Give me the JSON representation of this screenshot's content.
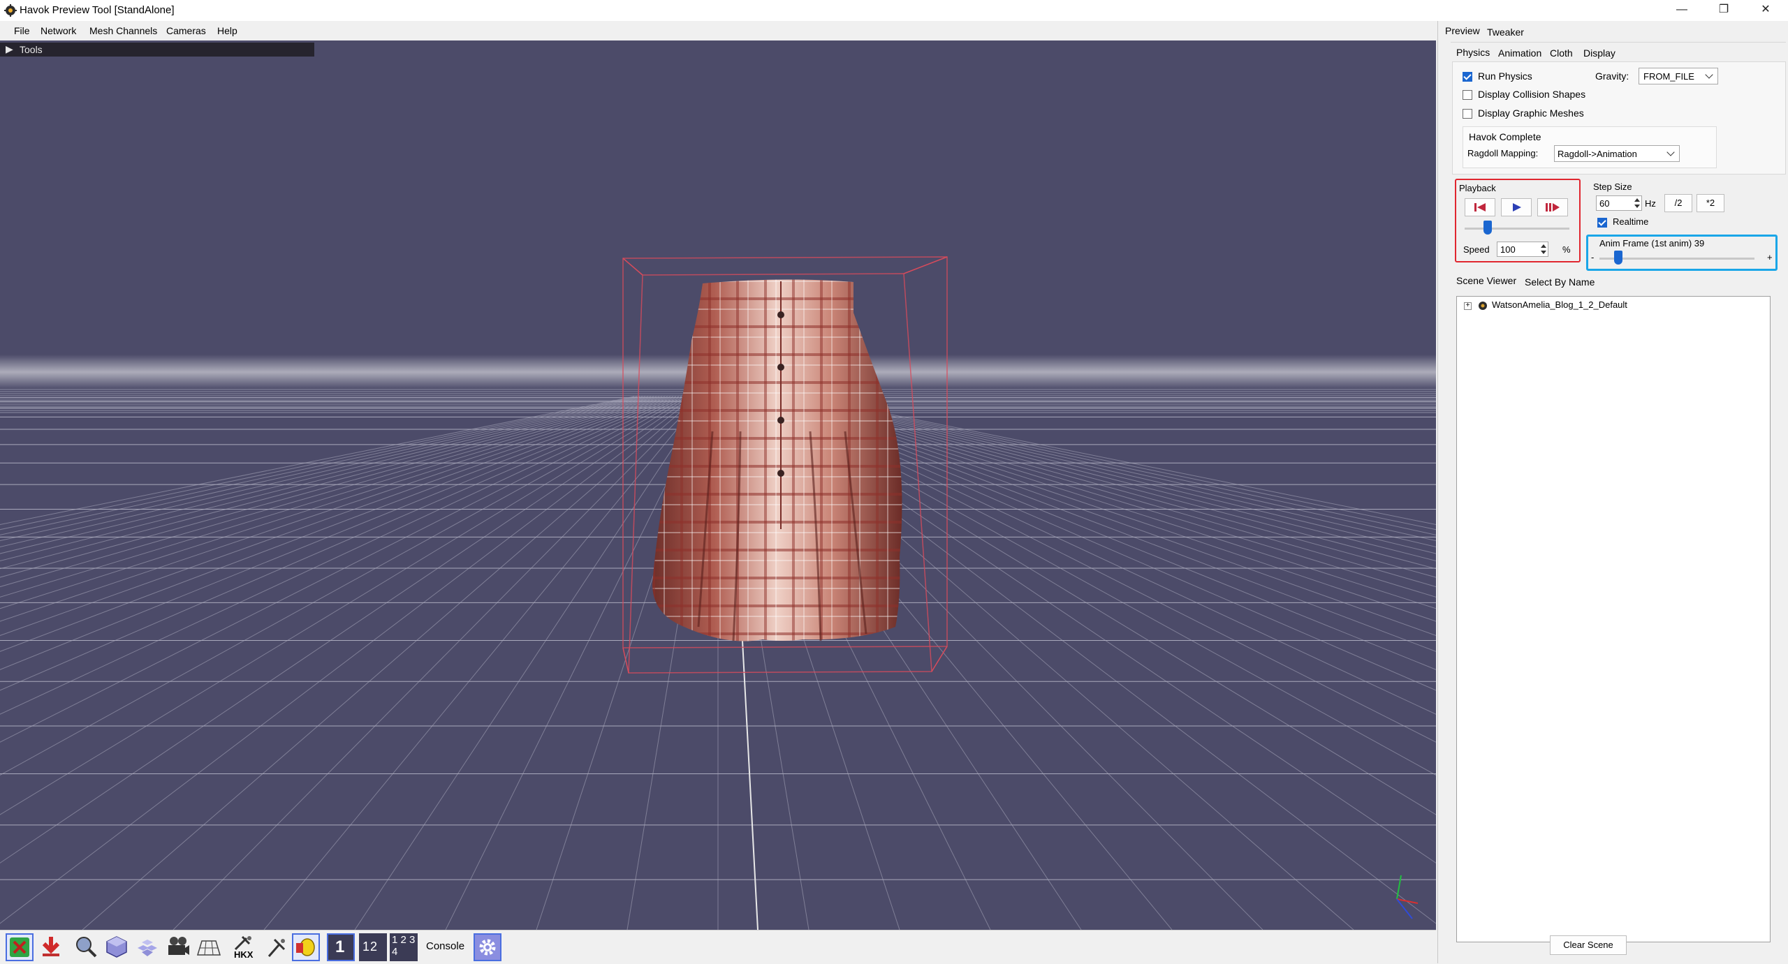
{
  "window": {
    "title": "Havok Preview Tool [StandAlone]",
    "minimize_glyph": "—",
    "restore_glyph": "❐",
    "close_glyph": "✕"
  },
  "menu": [
    "File",
    "Network",
    "Mesh Channels",
    "Cameras",
    "Help"
  ],
  "viewport": {
    "tools_label": "Tools",
    "background_color": "#4c4b69",
    "grid_color": "#c9c9d8",
    "bbox_color": "#d84b5b"
  },
  "toolbar": {
    "icons": [
      "cancel-icon",
      "import-icon",
      "zoom-icon",
      "cube-icon",
      "cubes-icon",
      "camera-icon",
      "grid-icon",
      "hkx-icon",
      "pin-icon",
      "light-icon"
    ],
    "hkx_label": "HKX",
    "layout_single": "1",
    "layout_two": "1 2",
    "layout_four": "1 2 3 4",
    "console_label": "Console"
  },
  "panel": {
    "top_tabs": [
      "Preview",
      "Tweaker"
    ],
    "sub_tabs": [
      "Physics",
      "Animation",
      "Cloth",
      "Display"
    ],
    "run_physics": {
      "label": "Run Physics",
      "checked": true
    },
    "display_collision": {
      "label": "Display Collision Shapes",
      "checked": false
    },
    "display_graphic": {
      "label": "Display Graphic Meshes",
      "checked": false
    },
    "gravity": {
      "label": "Gravity:",
      "value": "FROM_FILE"
    },
    "havok_complete": {
      "title": "Havok Complete",
      "ragdoll_label": "Ragdoll Mapping:",
      "ragdoll_value": "Ragdoll->Animation"
    },
    "playback": {
      "title": "Playback",
      "speed_label": "Speed",
      "speed_value": "100",
      "speed_unit": "%",
      "slider_fraction": 0.22
    },
    "step_size": {
      "title": "Step Size",
      "value": "60",
      "unit": "Hz",
      "half_label": "/2",
      "double_label": "*2",
      "realtime_label": "Realtime",
      "realtime_checked": true
    },
    "anim_frame": {
      "label": "Anim Frame (1st anim) 39",
      "minus": "-",
      "plus": "+",
      "slider_fraction": 0.12
    },
    "scene_tabs": [
      "Scene Viewer",
      "Select By Name"
    ],
    "scene_tree": [
      {
        "label": "WatsonAmelia_Blog_1_2_Default"
      }
    ],
    "clear_scene_label": "Clear Scene"
  },
  "highlights": {
    "red": "#e0262f",
    "blue": "#1aa6e8"
  }
}
